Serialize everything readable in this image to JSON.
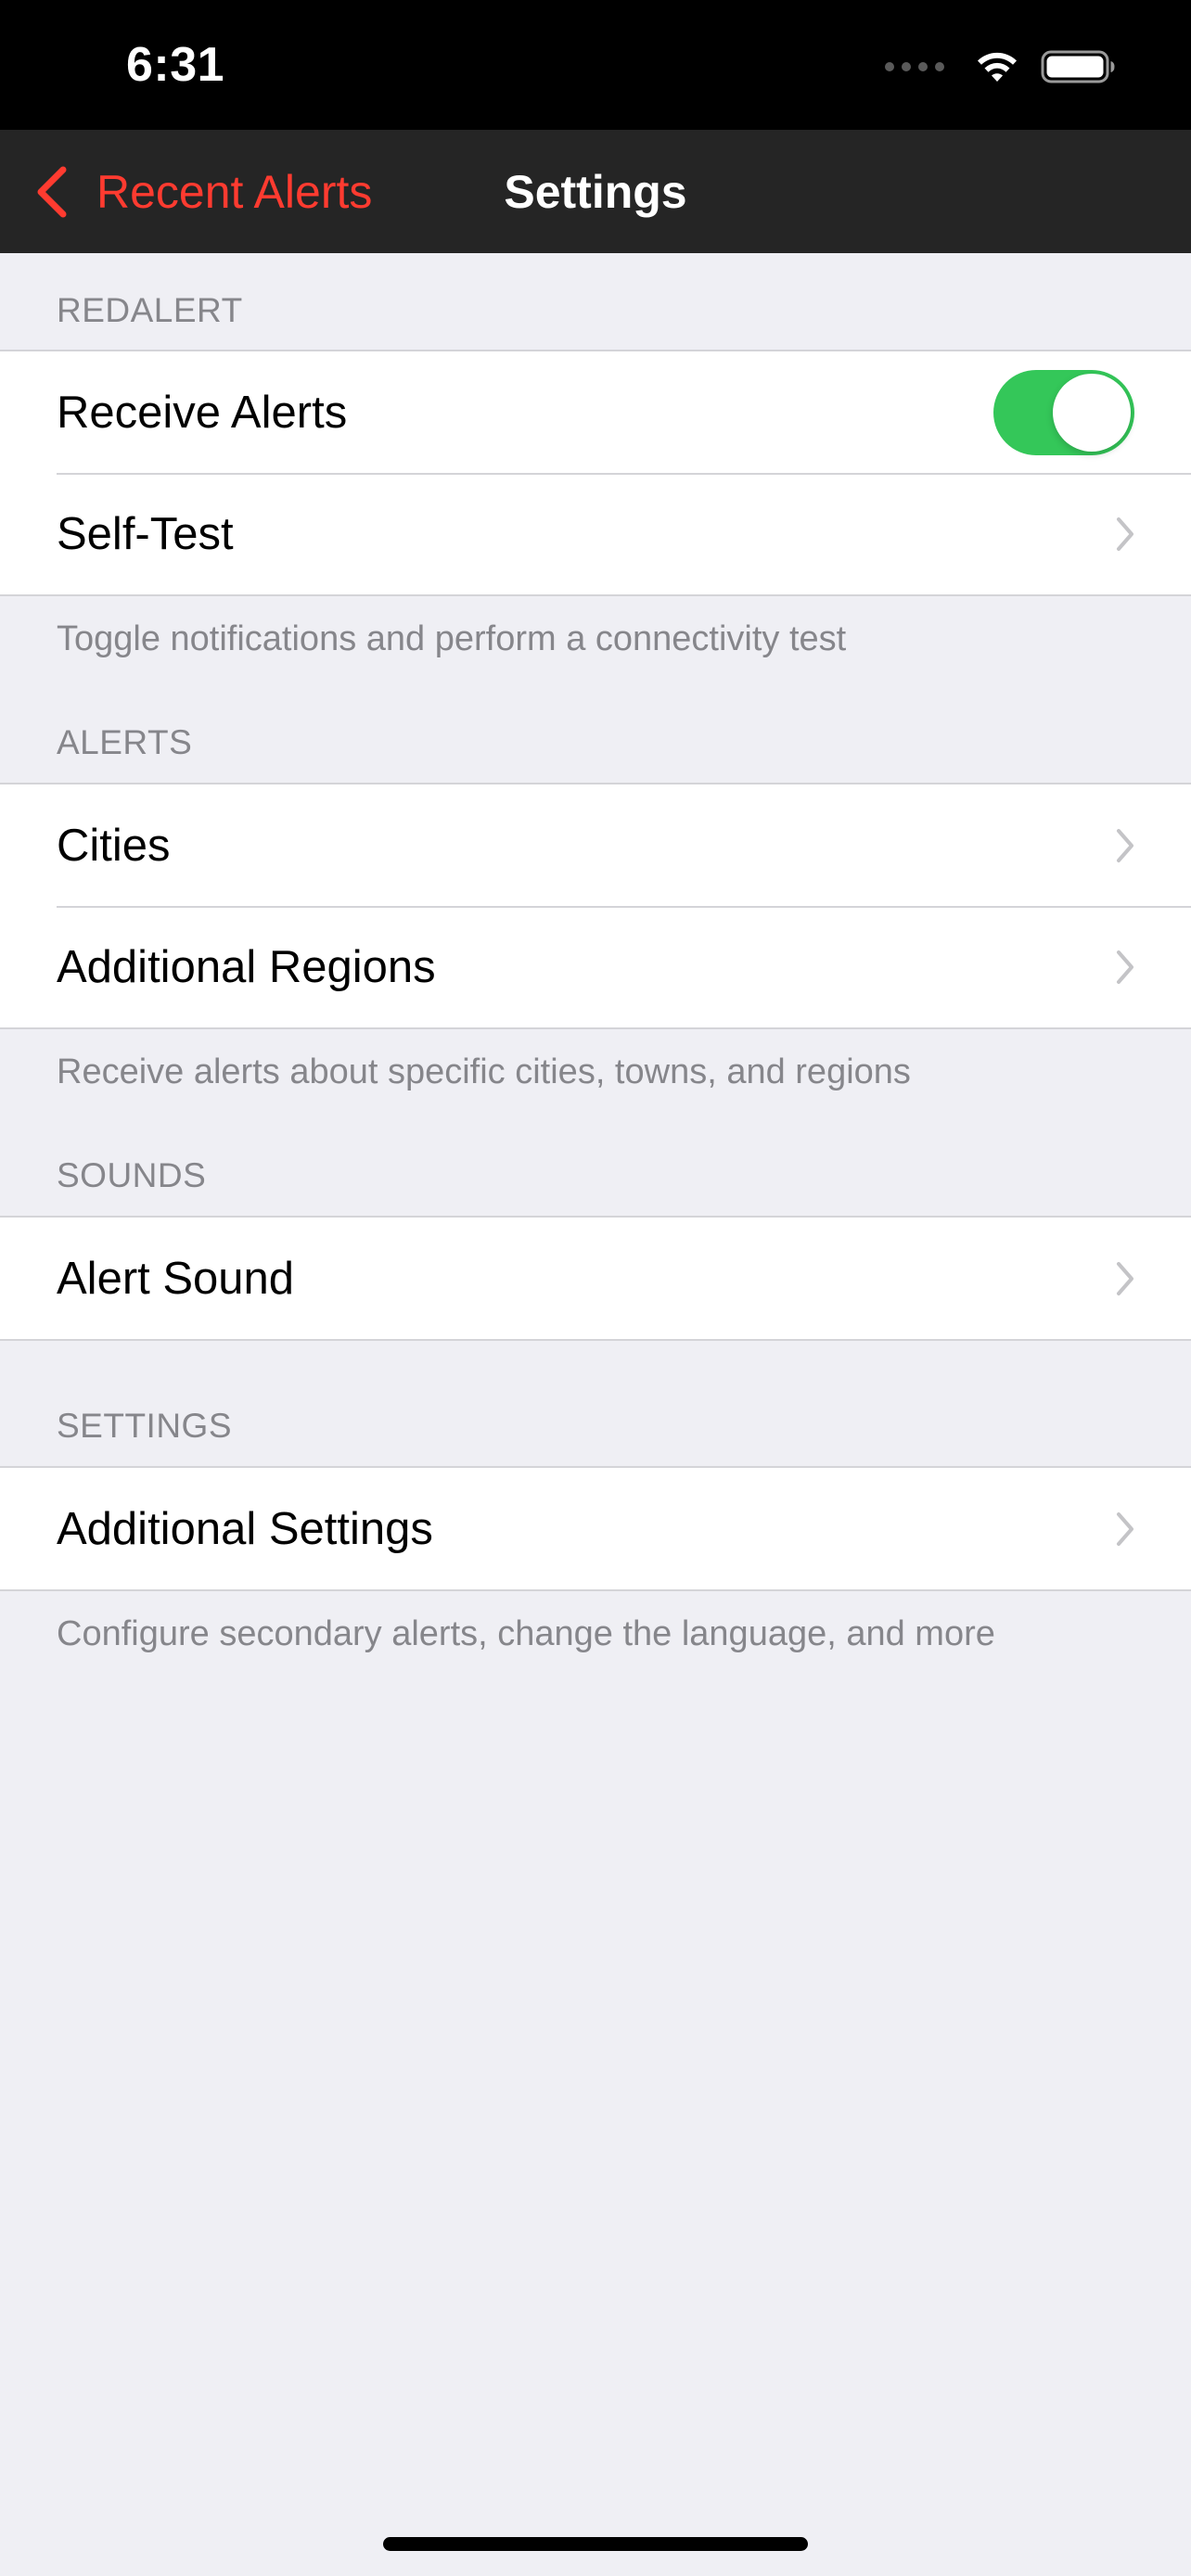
{
  "status_bar": {
    "time": "6:31"
  },
  "nav": {
    "back_label": "Recent Alerts",
    "title": "Settings"
  },
  "sections": {
    "redalert": {
      "header": "REDALERT",
      "receive_alerts": {
        "label": "Receive Alerts",
        "toggle_on": true
      },
      "self_test": {
        "label": "Self-Test"
      },
      "footer": "Toggle notifications and perform a connectivity test"
    },
    "alerts": {
      "header": "ALERTS",
      "cities": {
        "label": "Cities"
      },
      "additional_regions": {
        "label": "Additional Regions"
      },
      "footer": "Receive alerts about specific cities, towns, and regions"
    },
    "sounds": {
      "header": "SOUNDS",
      "alert_sound": {
        "label": "Alert Sound"
      }
    },
    "settings": {
      "header": "SETTINGS",
      "additional_settings": {
        "label": "Additional Settings"
      },
      "footer": "Configure secondary alerts, change the language, and more"
    }
  },
  "colors": {
    "accent": "#ff3b30",
    "toggle_on": "#34c759",
    "background": "#efeff4",
    "nav_bar": "#252525",
    "secondary_text": "#86868b"
  },
  "icons": [
    "wifi-icon",
    "battery-icon",
    "back-chevron-icon",
    "chevron-right-icon"
  ]
}
